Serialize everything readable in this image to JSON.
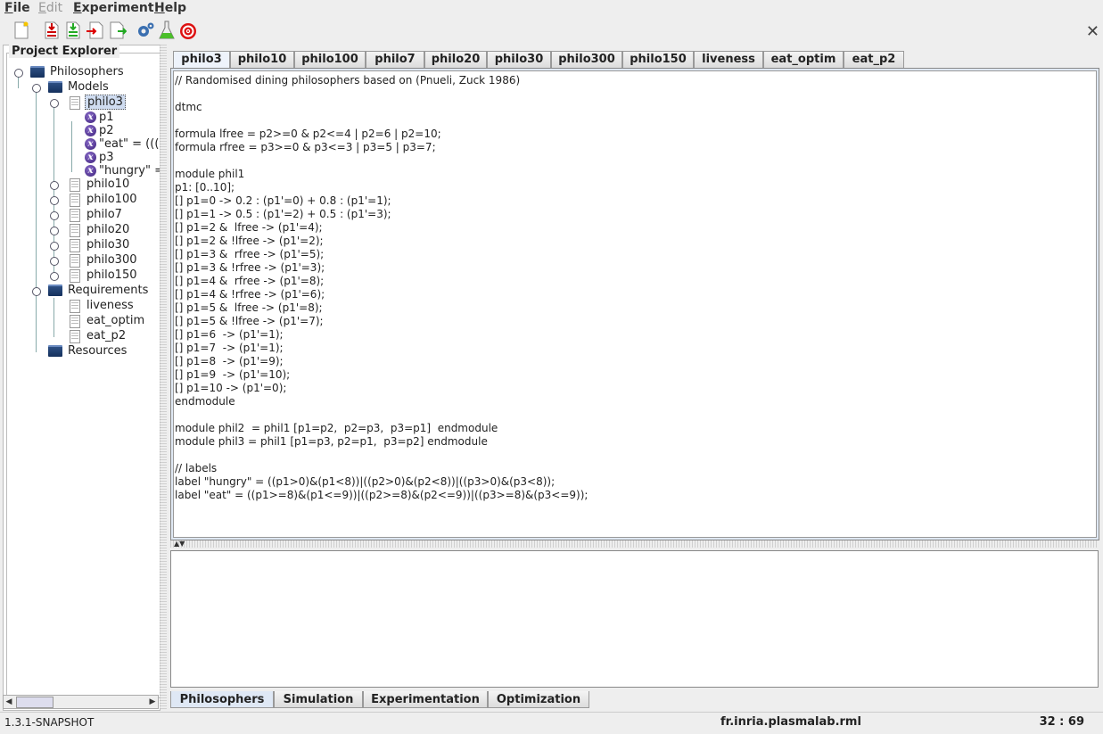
{
  "menubar": {
    "items": [
      {
        "label": "File",
        "mnemonic": "F",
        "rest": "ile",
        "enabled": true
      },
      {
        "label": "Edit",
        "mnemonic": "E",
        "rest": "dit",
        "enabled": false
      },
      {
        "label": "Experiment",
        "mnemonic": "E",
        "rest": "xperiment",
        "enabled": true
      },
      {
        "label": "Help",
        "mnemonic": "H",
        "rest": "elp",
        "enabled": true
      }
    ]
  },
  "toolbar": {
    "icons": [
      "new-file-icon",
      "save-red-icon",
      "save-green-icon",
      "export-icon",
      "import-icon",
      "settings-gear-icon",
      "flask-icon",
      "target-icon"
    ],
    "close": "✕"
  },
  "explorer": {
    "title": "Project Explorer",
    "root": "Philosophers",
    "models_label": "Models",
    "selected_model": "philo3",
    "variables": [
      "p1",
      "p2",
      "\"eat\" = ((((",
      "p3",
      "\"hungry\" ="
    ],
    "models": [
      "philo10",
      "philo100",
      "philo7",
      "philo20",
      "philo30",
      "philo300",
      "philo150"
    ],
    "requirements_label": "Requirements",
    "requirements": [
      "liveness",
      "eat_optim",
      "eat_p2"
    ],
    "resources_label": "Resources"
  },
  "editor": {
    "tabs": [
      "philo3",
      "philo10",
      "philo100",
      "philo7",
      "philo20",
      "philo30",
      "philo300",
      "philo150",
      "liveness",
      "eat_optim",
      "eat_p2"
    ],
    "active_tab": "philo3",
    "code": "// Randomised dining philosophers based on (Pnueli, Zuck 1986)\n\ndtmc\n\nformula lfree = p2>=0 & p2<=4 | p2=6 | p2=10;\nformula rfree = p3>=0 & p3<=3 | p3=5 | p3=7;\n\nmodule phil1\np1: [0..10];\n[] p1=0 -> 0.2 : (p1'=0) + 0.8 : (p1'=1);\n[] p1=1 -> 0.5 : (p1'=2) + 0.5 : (p1'=3);\n[] p1=2 &  lfree -> (p1'=4);\n[] p1=2 & !lfree -> (p1'=2);\n[] p1=3 &  rfree -> (p1'=5);\n[] p1=3 & !rfree -> (p1'=3);\n[] p1=4 &  rfree -> (p1'=8);\n[] p1=4 & !rfree -> (p1'=6);\n[] p1=5 &  lfree -> (p1'=8);\n[] p1=5 & !lfree -> (p1'=7);\n[] p1=6  -> (p1'=1);\n[] p1=7  -> (p1'=1);\n[] p1=8  -> (p1'=9);\n[] p1=9  -> (p1'=10);\n[] p1=10 -> (p1'=0);\nendmodule\n\nmodule phil2  = phil1 [p1=p2,  p2=p3,  p3=p1]  endmodule\nmodule phil3 = phil1 [p1=p3, p2=p1,  p3=p2] endmodule\n\n// labels\nlabel \"hungry\" = ((p1>0)&(p1<8))|((p2>0)&(p2<8))|((p3>0)&(p3<8));\nlabel \"eat\" = ((p1>=8)&(p1<=9))|((p2>=8)&(p2<=9))|((p3>=8)&(p3<=9));"
  },
  "bottom_tabs": [
    "Philosophers",
    "Simulation",
    "Experimentation",
    "Optimization"
  ],
  "active_bottom_tab": "Philosophers",
  "status": {
    "version": "1.3.1-SNAPSHOT",
    "module": "fr.inria.plasmalab.rml",
    "position": "32 : 69"
  }
}
